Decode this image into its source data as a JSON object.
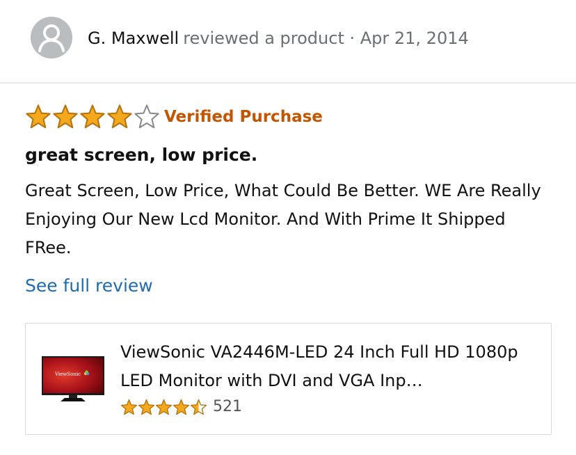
{
  "header": {
    "reviewer_name": "G. Maxwell",
    "action_text": "reviewed a product · Apr 21, 2014",
    "avatar_icon": "user-silhouette-icon"
  },
  "review": {
    "rating": 4,
    "max_rating": 5,
    "star_color": "#f4a81d",
    "verified_label": "Verified Purchase",
    "verified_color": "#c45500",
    "title": "great screen, low price.",
    "body": "Great Screen, Low Price, What Could Be Better. WE Are Really Enjoying Our New Lcd Monitor. And With Prime It Shipped FRee.",
    "see_full_label": "See full review",
    "link_color": "#1f6bb3"
  },
  "product": {
    "title": "ViewSonic VA2446M-LED 24 Inch Full HD 1080p LED Monitor with DVI and VGA Inp…",
    "rating": 4.5,
    "rating_count": "521",
    "image_icon": "monitor-icon",
    "image_brand_text": "ViewSonic"
  }
}
